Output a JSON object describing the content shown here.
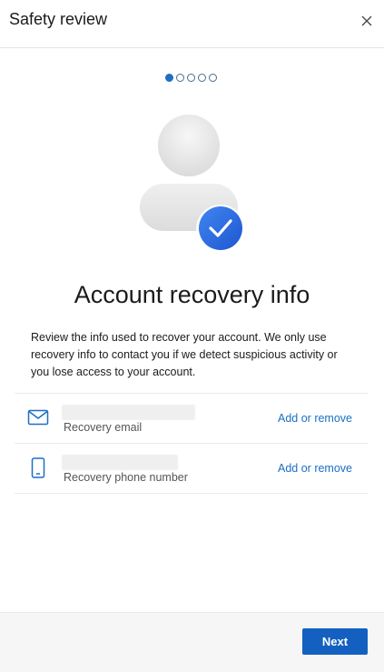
{
  "header": {
    "title": "Safety review",
    "close_icon": "close-icon"
  },
  "steps": {
    "count": 5,
    "current": 1
  },
  "hero": {
    "icon": "user-verified-illustration"
  },
  "main": {
    "title": "Account recovery info",
    "description": "Review the info used to recover your account. We only use recovery info to contact you if we detect suspicious activity or you lose access to your account."
  },
  "recovery_items": [
    {
      "icon": "mail-icon",
      "label": "Recovery email",
      "action": "Add or remove"
    },
    {
      "icon": "phone-icon",
      "label": "Recovery phone number",
      "action": "Add or remove"
    }
  ],
  "footer": {
    "next_label": "Next"
  },
  "colors": {
    "accent": "#1b6fc6",
    "button": "#1460c0",
    "check_badge": "#2f6fe0"
  }
}
